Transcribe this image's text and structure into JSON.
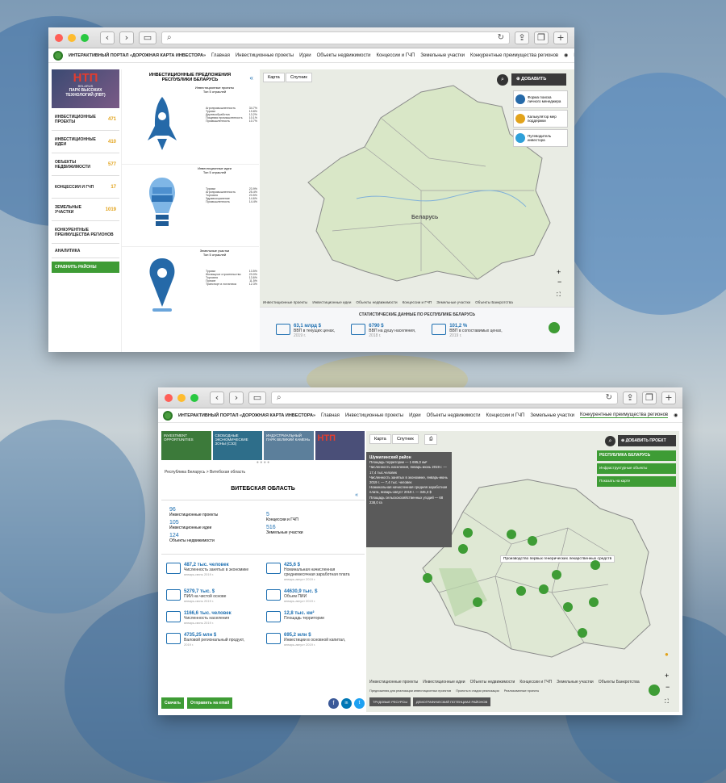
{
  "w1": {
    "portal_title": "ИНТЕРАКТИВНЫЙ ПОРТАЛ «ДОРОЖНАЯ КАРТА ИНВЕСТОРА»",
    "nav": [
      "Главная",
      "Инвестиционные проекты",
      "Идеи",
      "Объекты недвижимости",
      "Концессии и ГЧП",
      "Земельные участки",
      "Конкурентные преимущества регионов"
    ],
    "langs": [
      "RU",
      "EN",
      "ZH"
    ],
    "banner": {
      "big": "НТП",
      "sub": "BELARUS",
      "line1": "ПАРК ВЫСОКИХ",
      "line2": "ТЕХНОЛОГИЙ (ПВТ)"
    },
    "menu": [
      {
        "label": "ИНВЕСТИЦИОННЫЕ ПРОЕКТЫ",
        "count": "471"
      },
      {
        "label": "ИНВЕСТИЦИОННЫЕ ИДЕИ",
        "count": "410"
      },
      {
        "label": "ОБЪЕКТЫ НЕДВИЖИМОСТИ",
        "count": "577"
      },
      {
        "label": "КОНЦЕССИИ И ГЧП",
        "count": "17"
      },
      {
        "label": "ЗЕМЕЛЬНЫЕ УЧАСТКИ",
        "count": "1019"
      },
      {
        "label": "КОНКУРЕНТНЫЕ ПРЕИМУЩЕСТВА РЕГИОНОВ",
        "count": ""
      },
      {
        "label": "АНАЛИТИКА",
        "count": ""
      }
    ],
    "compare_btn": "СРАВНИТЬ РАЙОНЫ",
    "panel_title": "ИНВЕСТИЦИОННЫЕ ПРЕДЛОЖЕНИЯ РЕСПУБЛИКИ БЕЛАРУСЬ",
    "panel_collapse": "«",
    "blocks": [
      {
        "title": "Инвестиционные проекты",
        "sub": "Топ 5 отраслей",
        "items": [
          {
            "n": "Агропромышленность",
            "v": "34.7%"
          },
          {
            "n": "Туризм",
            "v": "19.8%"
          },
          {
            "n": "Деревообработка",
            "v": "13.2%"
          },
          {
            "n": "Пищевая промышленность",
            "v": "10.1%"
          },
          {
            "n": "Промышленность",
            "v": "10.7%"
          }
        ]
      },
      {
        "title": "Инвестиционные идеи",
        "sub": "Топ 5 отраслей",
        "items": [
          {
            "n": "Туризм",
            "v": "23.9%"
          },
          {
            "n": "Агропромышленность",
            "v": "25.4%"
          },
          {
            "n": "Торговля",
            "v": "23.5%"
          },
          {
            "n": "Здравоохранение",
            "v": "14.6%"
          },
          {
            "n": "Промышленность",
            "v": "14.4%"
          }
        ]
      },
      {
        "title": "Земельные участки",
        "sub": "Топ 5 отраслей",
        "items": [
          {
            "n": "Туризм",
            "v": "13.5%"
          },
          {
            "n": "Жилищное строительство",
            "v": "23.0%"
          },
          {
            "n": "Торговля",
            "v": "13.6%"
          },
          {
            "n": "Прочие",
            "v": "11.5%"
          },
          {
            "n": "Транспорт и логистика",
            "v": "12.3%"
          }
        ]
      }
    ],
    "map_tabs": [
      "Карта",
      "Спутник"
    ],
    "add_btn": "ДОБАВИТЬ",
    "side_cards": [
      "Форма поиска личного менеджера",
      "Калькулятор мер поддержки",
      "Путеводитель инвестора"
    ],
    "country": "Беларусь",
    "legend": [
      "Инвестиционные проекты",
      "Инвестиционные идеи",
      "Объекты недвижимости",
      "Концессии и ГЧП",
      "Земельные участки",
      "Объекты Банкротства"
    ],
    "stats_title": "СТАТИСТИЧЕСКИЕ ДАННЫЕ ПО РЕСПУБЛИКЕ БЕЛАРУСЬ",
    "stats": [
      {
        "v": "63,1 млрд $",
        "l": "ВВП в текущих ценах,",
        "y": "2019 г."
      },
      {
        "v": "6790 $",
        "l": "ВВП на душу населения,",
        "y": "2018 г."
      },
      {
        "v": "101,2 %",
        "l": "ВВП в сопоставимых ценах,",
        "y": "2019 г."
      }
    ]
  },
  "w2": {
    "portal_title": "ИНТЕРАКТИВНЫЙ ПОРТАЛ «ДОРОЖНАЯ КАРТА ИНВЕСТОРА»",
    "nav": [
      "Главная",
      "Инвестиционные проекты",
      "Идеи",
      "Объекты недвижимости",
      "Концессии и ГЧП",
      "Земельные участки",
      "Конкурентные преимущества регионов"
    ],
    "langs": [
      "RU",
      "EN",
      "ZH"
    ],
    "banners": [
      "INVESTMENT OPPORTUNITIES",
      "СВОБОДНЫЕ ЭКОНОМИЧЕСКИЕ ЗОНЫ (СЭЗ)",
      "ИНДУСТРИАЛЬНЫЙ ПАРК ВЕЛИКИЙ КАМЕНЬ",
      "НТП"
    ],
    "breadcrumb": "Республика Беларусь > Витебская область",
    "region": "ВИТЕБСКАЯ ОБЛАСТЬ",
    "counts": [
      {
        "v": "96",
        "l": "Инвестиционные проекты"
      },
      {
        "v": "5",
        "l": "Концессии и ГЧП"
      },
      {
        "v": "105",
        "l": "Инвестиционные идеи"
      },
      {
        "v": "516",
        "l": "Земельные участки"
      },
      {
        "v": "124",
        "l": "Объекты недвижимости"
      }
    ],
    "stats": [
      {
        "v": "487,2 тыс. человек",
        "l": "Численность занятых в экономике",
        "y": "январь-июнь 2019 г."
      },
      {
        "v": "425,6 $",
        "l": "Номинальная начисленная среднемесячная заработная плата",
        "y": "январь-август 2019 г."
      },
      {
        "v": "5279,7 тыс. $",
        "l": "ПИИ на чистой основе",
        "y": "январь-июнь 2019 г."
      },
      {
        "v": "44630,9 тыс. $",
        "l": "Объем ПИИ",
        "y": "январь-август 2019 г."
      },
      {
        "v": "1166,6 тыс. человек",
        "l": "Численность населения",
        "y": "январь-июнь 2019 г."
      },
      {
        "v": "12,8 тыс. км²",
        "l": "Площадь территории",
        "y": ""
      },
      {
        "v": "4735,25 млн $",
        "l": "Валовой региональный продукт,",
        "y": "2019 г."
      },
      {
        "v": "695,2 млн $",
        "l": "Инвестиции в основной капитал,",
        "y": "январь-август 2019 г."
      }
    ],
    "download_btn": "Скачать",
    "email_btn": "Отправить на email",
    "map_tabs": [
      "Карта",
      "Спутник"
    ],
    "add_btn": "ДОБАВИТЬ ПРОЕКТ",
    "filters": [
      "РЕСПУБЛИКА БЕЛАРУСЬ",
      "Инфраструктурные объекты",
      "Показать на карте"
    ],
    "tooltip": {
      "title": "Шумилинский район",
      "lines": [
        "Площадь территории — 1 695,0 км²",
        "Численность населения, январь-июнь 2019 г. — 17,4 тыс.человек",
        "Численность занятых в экономике, январь-июнь 2019 г. — 7,4 тыс. человек",
        "Номинальная начисленная средняя заработная плата, январь-август 2019 г. — 345,3 $",
        "Площадь сельскохозяйственных угодий — 68 238,0 га"
      ]
    },
    "map_label": "Производство первых генерических лекарственных средств",
    "legend": [
      "Инвестиционные проекты",
      "Инвестиционные идеи",
      "Объекты недвижимости",
      "Концессии и ГЧП",
      "Земельные участки",
      "Объекты Банкротства"
    ],
    "legend2": [
      "Предложения для реализации инвестиционных проектов",
      "Проекты в стадии реализации",
      "Реализованные проекты"
    ],
    "bottom_tabs": [
      "ТРУДОВЫЕ РЕСУРСЫ",
      "ДЕМОГРАФИЧЕСКИЙ ПОТЕНЦИАЛ РАЙОНОВ"
    ]
  }
}
